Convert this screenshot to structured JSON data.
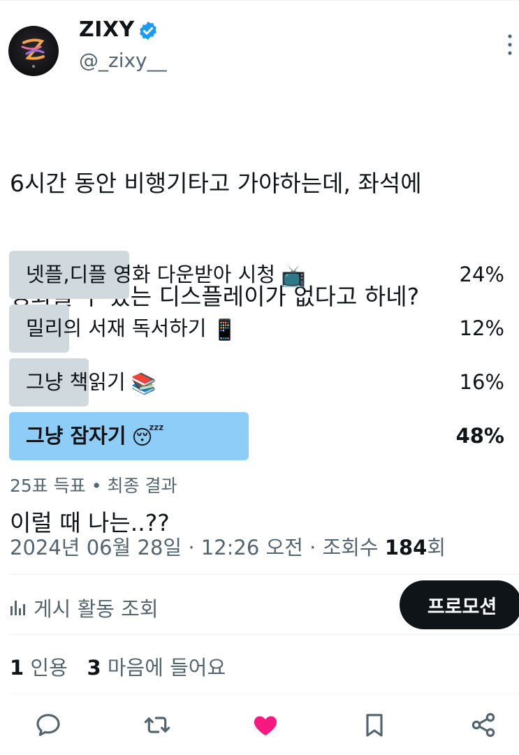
{
  "author": {
    "name": "ZIXY",
    "handle": "@_zixy__",
    "verified": true,
    "avatar_icon": "profile-avatar"
  },
  "tweet": {
    "lines": [
      "6시간 동안 비행기타고 가야하는데, 좌석에",
      "영화볼 수 있는 디스플레이가 없다고 하네?",
      "이럴 때 나는..??"
    ]
  },
  "poll": {
    "options": [
      {
        "label": "넷플,디플 영화 다운받아 시청",
        "emoji": "📺",
        "percent_text": "24%",
        "percent": 24
      },
      {
        "label": "밀리의 서재 독서하기",
        "emoji": "📱",
        "percent_text": "12%",
        "percent": 12
      },
      {
        "label": "그냥 책읽기",
        "emoji": "📚",
        "percent_text": "16%",
        "percent": 16
      },
      {
        "label": "그냥 잠자기",
        "emoji": "😴",
        "percent_text": "48%",
        "percent": 48,
        "winner": true
      }
    ],
    "votes": "25표 득표",
    "separator": "•",
    "status": "최종 결과"
  },
  "meta": {
    "date": "2024년 06월 28일",
    "sep": "·",
    "time": "12:26 오전",
    "views_label": "조회수",
    "views_count": "184",
    "views_suffix": "회"
  },
  "activity": {
    "label": "게시 활동 조회",
    "promote_label": "프로모션"
  },
  "engagement": {
    "quotes_count": "1",
    "quotes_label": "인용",
    "likes_count": "3",
    "likes_label": "마음에 들어요"
  },
  "colors": {
    "text": "#0f1419",
    "secondary": "#536471",
    "poll_bar": "#cfd9de",
    "poll_winner": "#8ecdf8",
    "verified": "#1d9bf0",
    "like": "#f91880"
  },
  "actions": [
    "reply-icon",
    "retweet-icon",
    "like-icon",
    "bookmark-icon",
    "share-icon"
  ]
}
